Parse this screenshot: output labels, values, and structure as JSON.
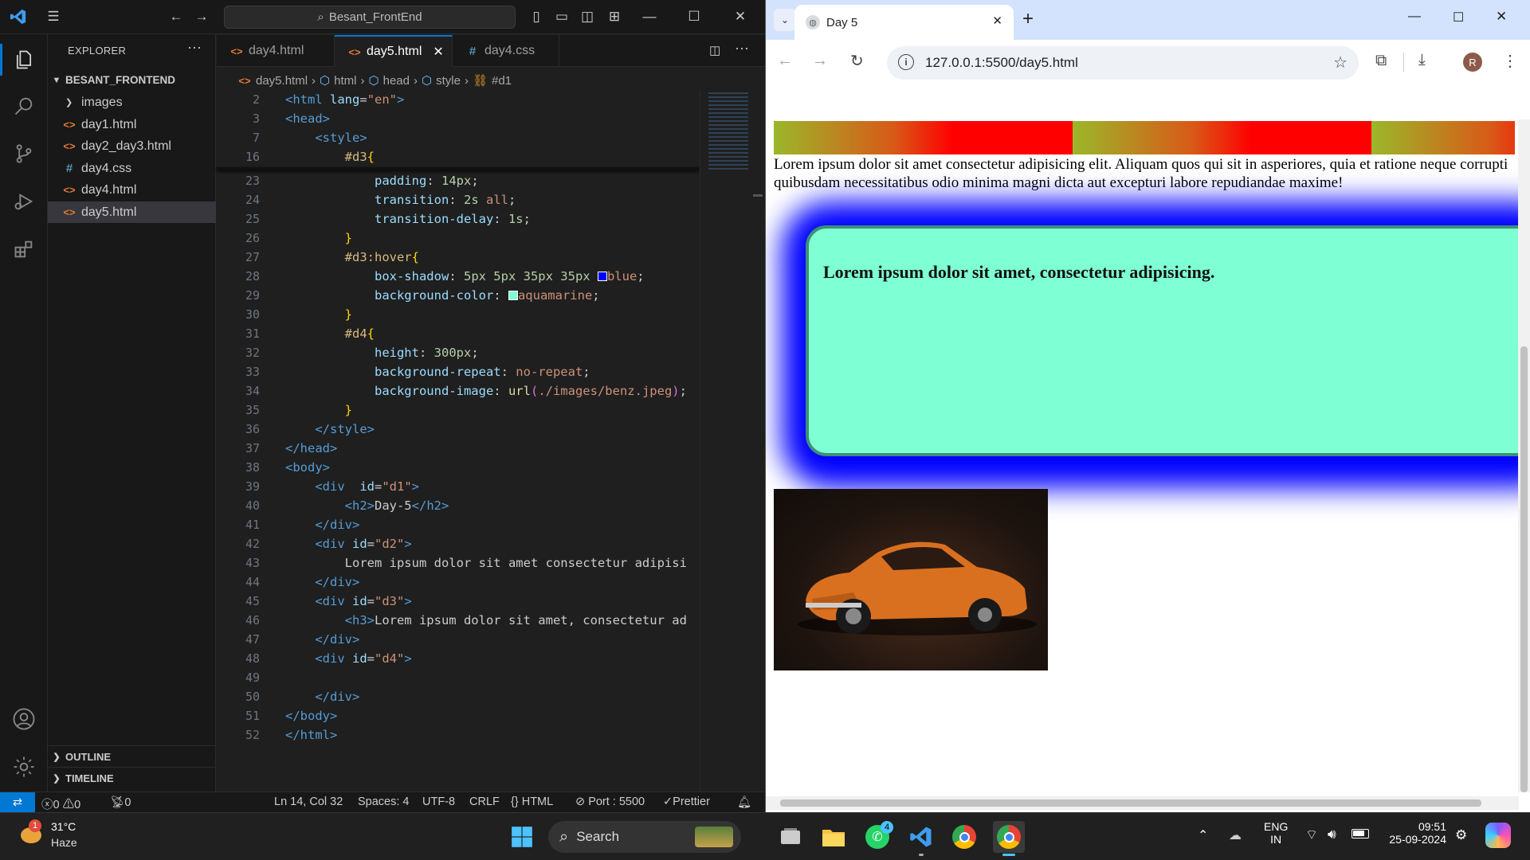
{
  "vscode": {
    "search": "Besant_FrontEnd",
    "explorer_title": "EXPLORER",
    "folder": "BESANT_FRONTEND",
    "files": [
      {
        "name": "images",
        "type": "folder"
      },
      {
        "name": "day1.html",
        "type": "html"
      },
      {
        "name": "day2_day3.html",
        "type": "html"
      },
      {
        "name": "day4.css",
        "type": "css"
      },
      {
        "name": "day4.html",
        "type": "html"
      },
      {
        "name": "day5.html",
        "type": "html"
      }
    ],
    "outline": "OUTLINE",
    "timeline": "TIMELINE",
    "tabs": [
      "day4.html",
      "day5.html",
      "day4.css"
    ],
    "breadcrumb": [
      "day5.html",
      "html",
      "head",
      "style",
      "#d1"
    ],
    "status": {
      "errors": "0",
      "warnings": "0",
      "ports": "0",
      "position": "Ln 14, Col 32",
      "spaces": "Spaces: 4",
      "encoding": "UTF-8",
      "eol": "CRLF",
      "language": "HTML",
      "port": "Port : 5500",
      "prettier": "Prettier"
    }
  },
  "chrome": {
    "tab_title": "Day 5",
    "url": "127.0.0.1:5500/day5.html",
    "profile_initial": "R",
    "page": {
      "paragraph": "Lorem ipsum dolor sit amet consectetur adipisicing elit. Aliquam quos qui sit in asperiores, quia et ratione neque corrupti quibusdam necessitatibus odio minima magni dicta aut excepturi labore repudiandae maxime!",
      "heading": "Lorem ipsum dolor sit amet, consectetur adipisicing."
    },
    "colors": {
      "box_bg": "#7fffd4",
      "shadow": "#0000ff"
    }
  },
  "taskbar": {
    "weather_temp": "31°C",
    "weather_desc": "Haze",
    "weather_badge": "1",
    "search": "Search",
    "whatsapp_badge": "4",
    "lang_top": "ENG",
    "lang_bottom": "IN",
    "time": "09:51",
    "date": "25-09-2024"
  }
}
